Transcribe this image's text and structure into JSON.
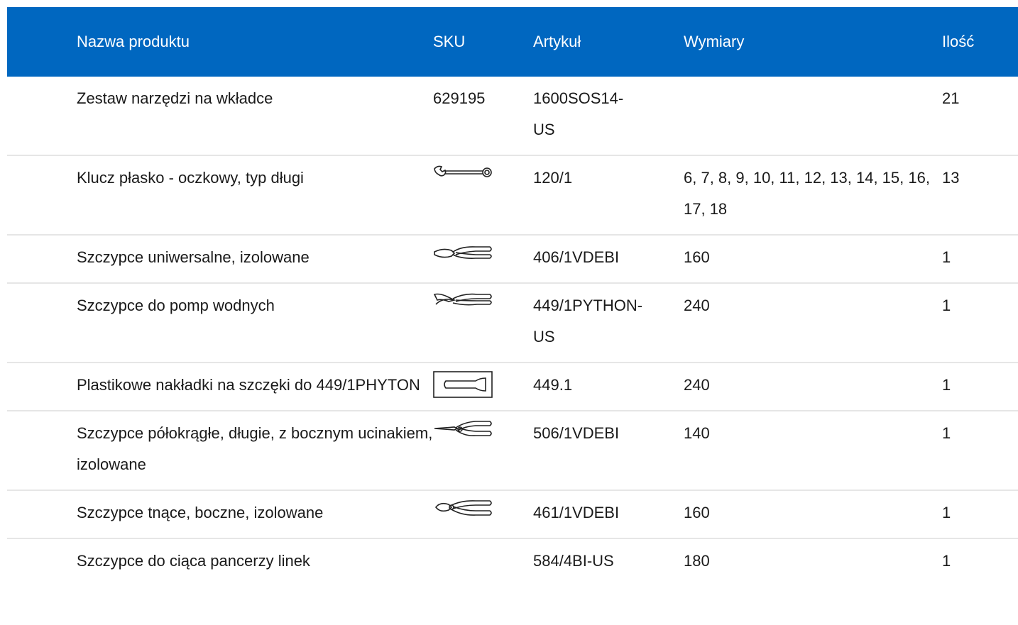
{
  "header": {
    "name": "Nazwa produktu",
    "sku": "SKU",
    "article": "Artykuł",
    "dimensions": "Wymiary",
    "quantity": "Ilość"
  },
  "rows": [
    {
      "name": "Zestaw narzędzi na wkładce",
      "sku": "629195",
      "article": "1600SOS14-US",
      "dimensions": "",
      "quantity": "21"
    },
    {
      "name": "Klucz płasko - oczkowy, typ długi",
      "sku_icon": "combination-wrench-icon",
      "article": "120/1",
      "dimensions": "6, 7, 8, 9, 10, 11, 12, 13, 14, 15, 16, 17, 18",
      "quantity": "13"
    },
    {
      "name": "Szczypce uniwersalne, izolowane",
      "sku_icon": "combination-pliers-icon",
      "article": "406/1VDEBI",
      "dimensions": "160",
      "quantity": "1"
    },
    {
      "name": "Szczypce do pomp wodnych",
      "sku_icon": "water-pump-pliers-icon",
      "article": "449/1PYTHON-US",
      "dimensions": "240",
      "quantity": "1"
    },
    {
      "name": "Plastikowe nakładki na szczęki do 449/1PHYTON",
      "sku_icon": "jaw-cover-icon",
      "article": "449.1",
      "dimensions": "240",
      "quantity": "1"
    },
    {
      "name": "Szczypce półokrągłe, długie, z bocznym ucinakiem, izolowane",
      "sku_icon": "long-nose-pliers-icon",
      "article": "506/1VDEBI",
      "dimensions": "140",
      "quantity": "1"
    },
    {
      "name": "Szczypce tnące, boczne, izolowane",
      "sku_icon": "side-cutter-icon",
      "article": "461/1VDEBI",
      "dimensions": "160",
      "quantity": "1"
    },
    {
      "name": "Szczypce do ciąca pancerzy linek",
      "sku_icon": "",
      "article": "584/4BI-US",
      "dimensions": "180",
      "quantity": "1"
    }
  ]
}
